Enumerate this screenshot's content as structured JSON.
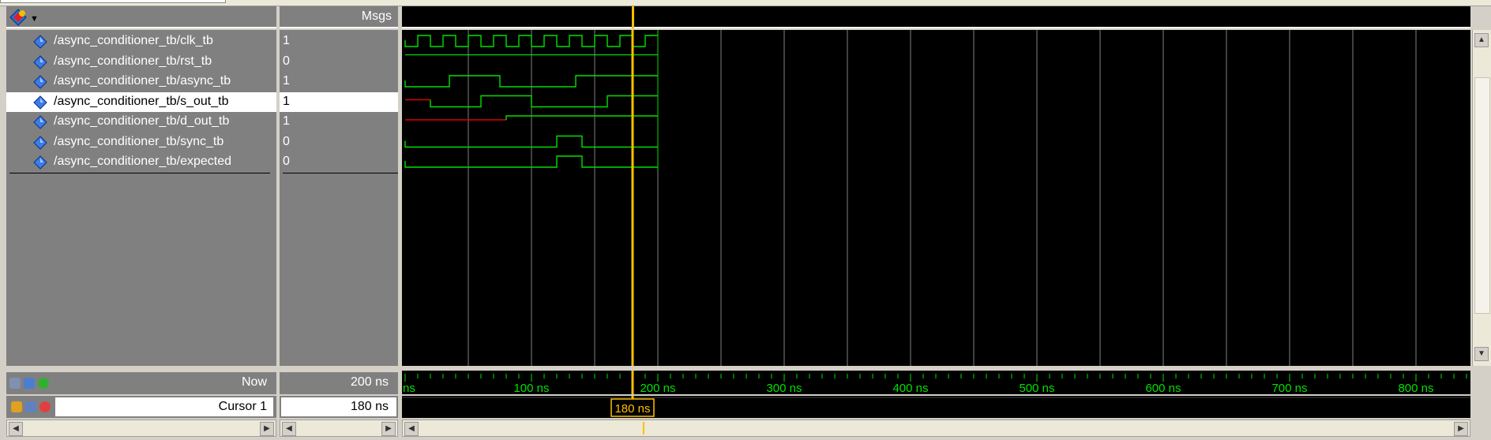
{
  "header": {
    "values_label": "Msgs"
  },
  "signals": [
    {
      "name": "/async_conditioner_tb/clk_tb",
      "value": "1"
    },
    {
      "name": "/async_conditioner_tb/rst_tb",
      "value": "0"
    },
    {
      "name": "/async_conditioner_tb/async_tb",
      "value": "1"
    },
    {
      "name": "/async_conditioner_tb/s_out_tb",
      "value": "1"
    },
    {
      "name": "/async_conditioner_tb/d_out_tb",
      "value": "1"
    },
    {
      "name": "/async_conditioner_tb/sync_tb",
      "value": "0"
    },
    {
      "name": "/async_conditioner_tb/expected",
      "value": "0"
    }
  ],
  "selected_signal": "/async_conditioner_tb/s_out_tb",
  "footer": {
    "now_label": "Now",
    "now_value": "200 ns",
    "cursor_label": "Cursor 1",
    "cursor_value": "180 ns"
  },
  "timeline": {
    "tick_labels": [
      "ns",
      "100 ns",
      "200 ns",
      "300 ns",
      "400 ns",
      "500 ns",
      "600 ns",
      "700 ns",
      "800 ns"
    ],
    "cursor_time_ns": 180,
    "simulated_until_ns": 200,
    "cursor_label": "180 ns"
  },
  "colors": {
    "wave": "#00e000",
    "undefined": "#e00000",
    "cursor": "#ffc000",
    "grid": "#808080",
    "ruler_text": "#00e000"
  },
  "icons": {
    "signal": "blue-diamond-icon",
    "header": "wave-tool-icon"
  }
}
